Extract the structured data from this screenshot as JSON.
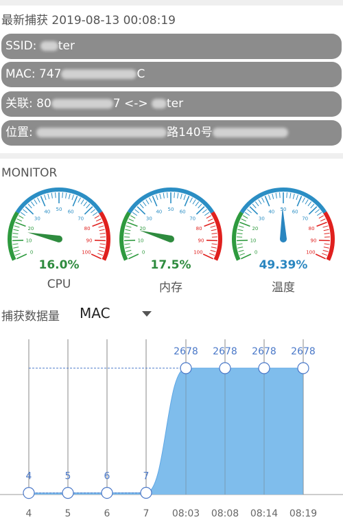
{
  "header": {
    "label": "最新捕获",
    "timestamp": "2019-08-13 00:08:19"
  },
  "info": [
    {
      "prefix": "SSID: ",
      "suffix": "ter"
    },
    {
      "prefix": "MAC: 747",
      "suffix": "C"
    },
    {
      "prefix": "关联: 80",
      "suffix": "7 <-> ",
      "tail": "ter"
    },
    {
      "prefix": "位置: ",
      "suffix": "路140号"
    }
  ],
  "monitor": {
    "title": "MONITOR"
  },
  "gauges": [
    {
      "label": "CPU",
      "value_text": "16.0%",
      "value": 16.0,
      "color": "#2e8b3e",
      "needle": "#2e8b3e"
    },
    {
      "label": "内存",
      "value_text": "17.5%",
      "value": 17.5,
      "color": "#2e8b3e",
      "needle": "#2e8b3e"
    },
    {
      "label": "温度",
      "value_text": "49.39%",
      "value": 49.39,
      "color": "#2a86c0",
      "needle": "#2a86c0"
    }
  ],
  "gauge_ticks": [
    "0",
    "10",
    "20",
    "30",
    "40",
    "50",
    "60",
    "70",
    "80",
    "90",
    "100"
  ],
  "capture": {
    "label": "捕获数据量",
    "selected": "MAC"
  },
  "chart_data": {
    "type": "area",
    "categories": [
      "4",
      "5",
      "6",
      "7",
      "08:03",
      "08:08",
      "08:14",
      "08:19"
    ],
    "values": [
      4,
      5,
      6,
      7,
      2678,
      2678,
      2678,
      2678
    ],
    "point_labels": [
      "4",
      "5",
      "6",
      "7",
      "2678",
      "2678",
      "2678",
      "2678"
    ],
    "fill_color": "#7fbdec",
    "label_color": "#4a78c8"
  }
}
